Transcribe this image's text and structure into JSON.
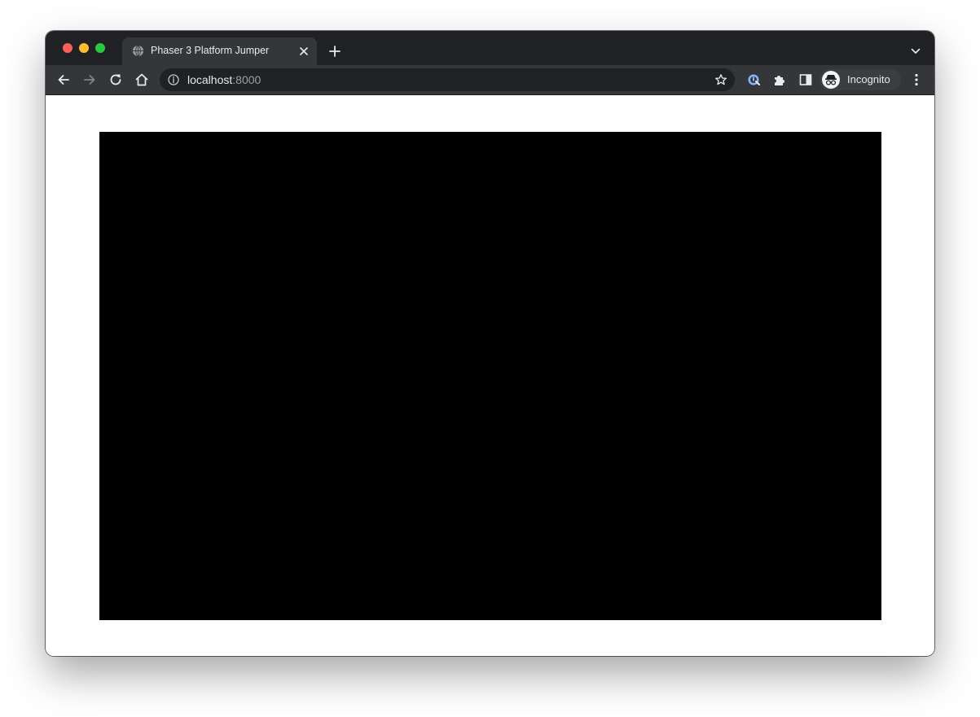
{
  "browser": {
    "tab": {
      "title": "Phaser 3 Platform Jumper",
      "favicon": "globe-icon"
    },
    "address_bar": {
      "host": "localhost",
      "port": ":8000"
    },
    "profile": {
      "label": "Incognito",
      "icon": "incognito-icon"
    }
  },
  "page": {
    "canvas_color": "#000000"
  }
}
